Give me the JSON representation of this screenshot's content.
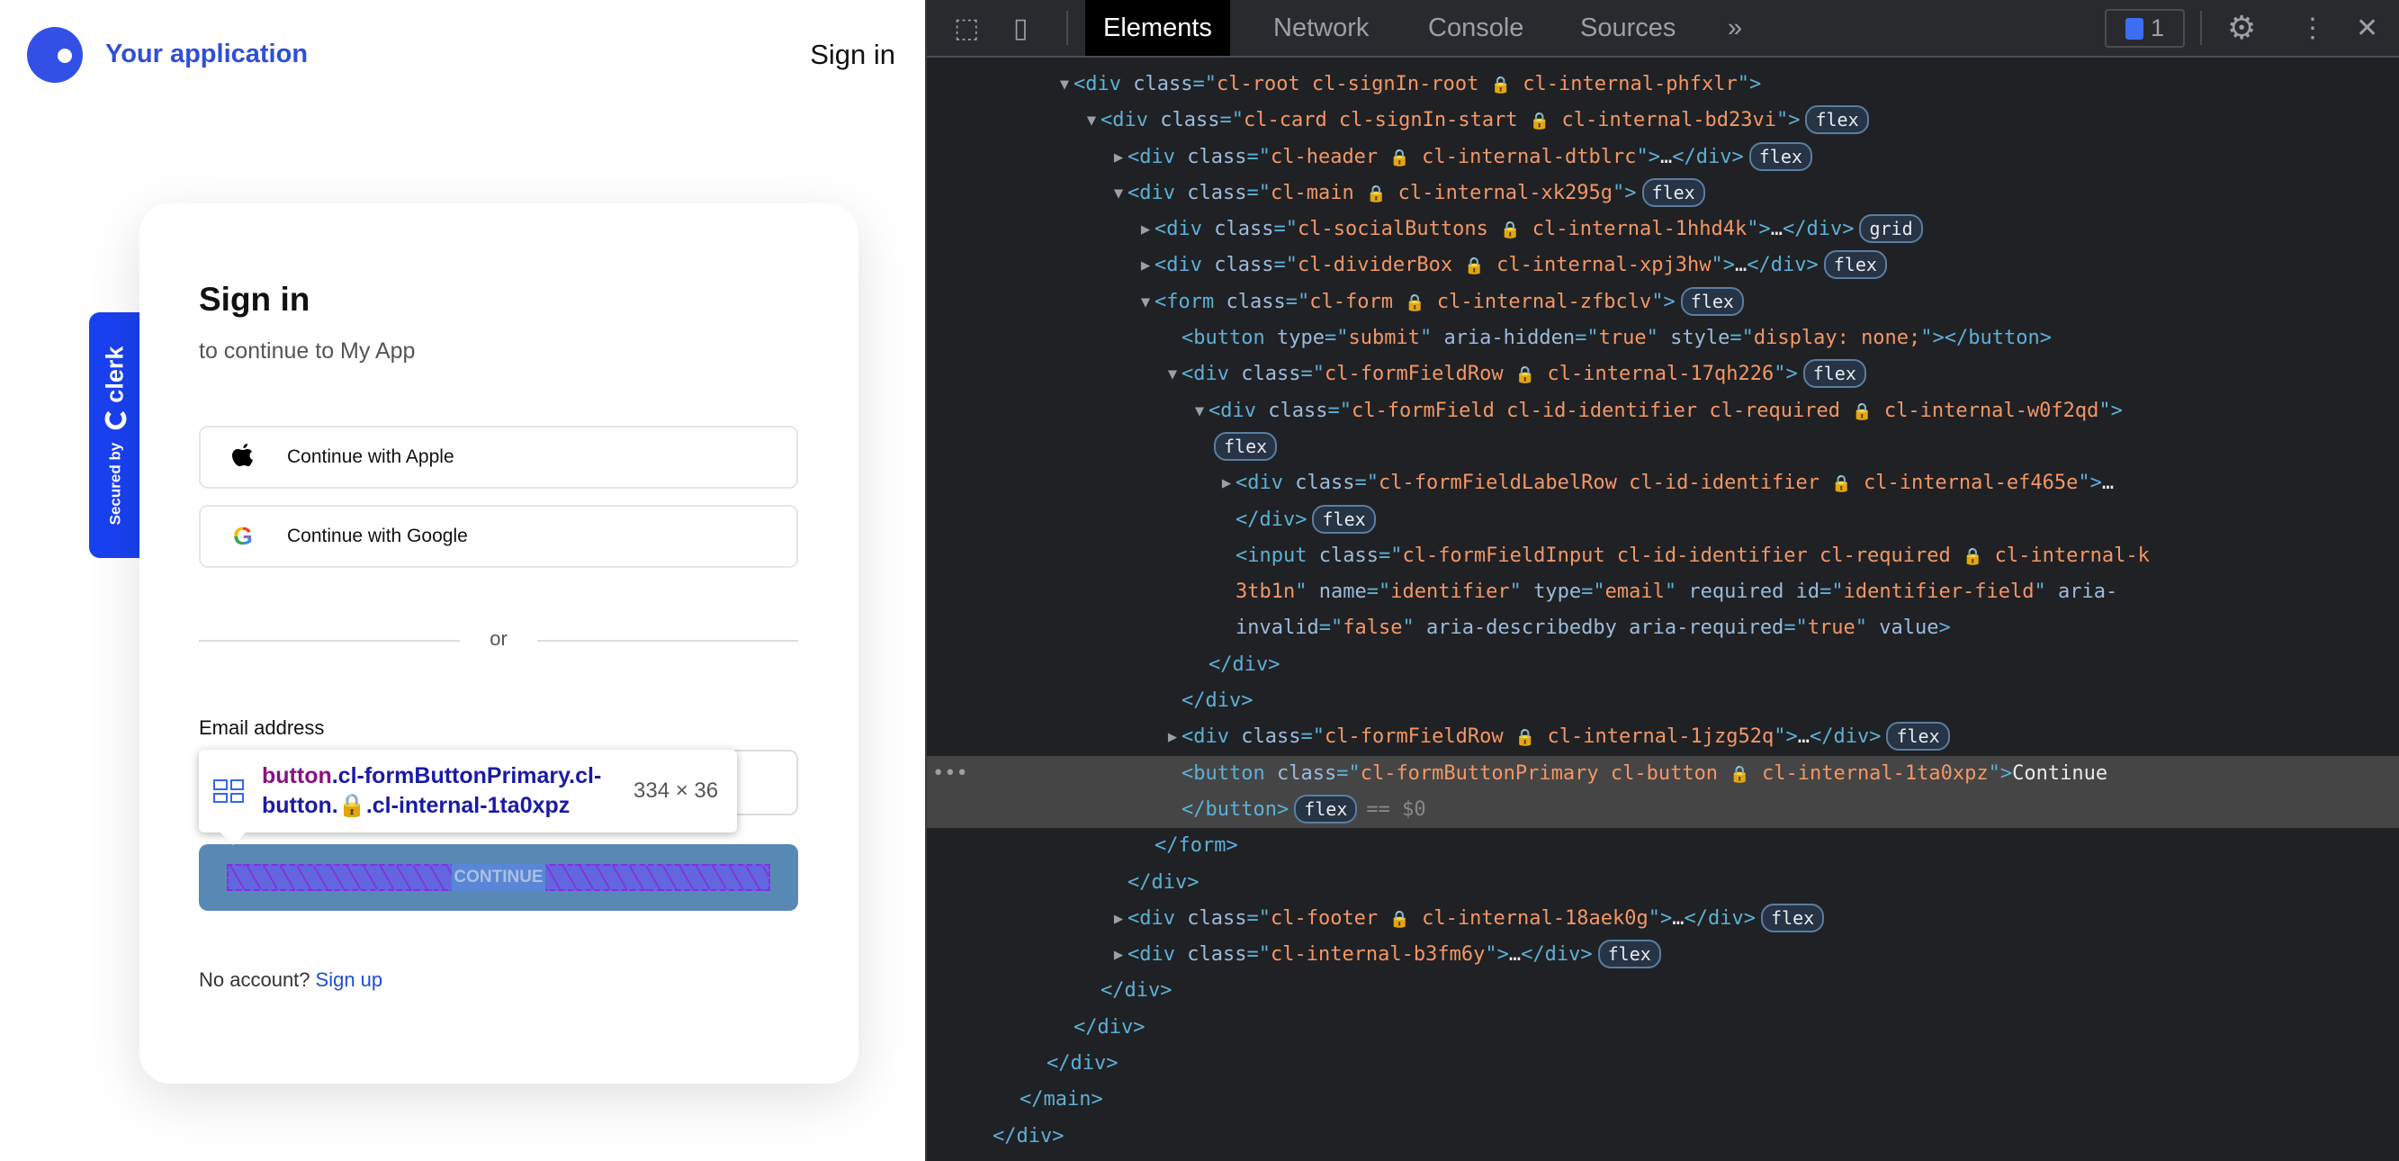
{
  "app": {
    "name": "Your application",
    "top_signin": "Sign in",
    "clerk_badge": {
      "secured_by": "Secured by",
      "brand": "clerk"
    },
    "card": {
      "title": "Sign in",
      "subtitle": "to continue to My App",
      "apple_label": "Continue with Apple",
      "google_label": "Continue with Google",
      "divider": "or",
      "email_label": "Email address",
      "email_value": "",
      "continue_label": "CONTINUE",
      "no_account": "No account?",
      "sign_up": "Sign up"
    },
    "inspect_tooltip": {
      "tag": "button",
      "selector_1": ".cl-formButtonPrimary.cl-",
      "selector_2": "button.",
      "selector_3": ".cl-internal-1ta0xpz",
      "size": "334 × 36"
    },
    "accent": "#1941f0",
    "highlight_color": "#5889b5"
  },
  "devtools": {
    "tabs": [
      "Elements",
      "Network",
      "Console",
      "Sources"
    ],
    "active_tab": "Elements",
    "more": "»",
    "issues_count": "1",
    "icons": [
      "inspect-icon",
      "device-toolbar-icon",
      "issues-icon",
      "gear-icon",
      "more-vertical-icon",
      "close-icon"
    ],
    "colors": {
      "background": "#202124",
      "tag": "#5db0d7",
      "attr_name": "#9bbbdc",
      "attr_value": "#f29766",
      "selected_row": "#454545"
    },
    "selected_suffix": "== $0",
    "lines": [
      {
        "d": 3,
        "t": "open",
        "s": [
          [
            "tag",
            "<div "
          ],
          [
            "an",
            "class"
          ],
          [
            "tag",
            "=\""
          ],
          [
            "av",
            "cl-root cl-signIn-root "
          ],
          [
            "lk",
            "🔒"
          ],
          [
            "av",
            " cl-internal-phfxlr"
          ],
          [
            "tag",
            "\">"
          ]
        ]
      },
      {
        "d": 4,
        "t": "open",
        "s": [
          [
            "tag",
            "<div "
          ],
          [
            "an",
            "class"
          ],
          [
            "tag",
            "=\""
          ],
          [
            "av",
            "cl-card cl-signIn-start "
          ],
          [
            "lk",
            "🔒"
          ],
          [
            "av",
            " cl-internal-bd23vi"
          ],
          [
            "tag",
            "\">"
          ],
          [
            "badge",
            "flex"
          ]
        ]
      },
      {
        "d": 5,
        "t": "closed",
        "s": [
          [
            "tag",
            "<div "
          ],
          [
            "an",
            "class"
          ],
          [
            "tag",
            "=\""
          ],
          [
            "av",
            "cl-header "
          ],
          [
            "lk",
            "🔒"
          ],
          [
            "av",
            " cl-internal-dtblrc"
          ],
          [
            "tag",
            "\">"
          ],
          [
            "tx",
            "…"
          ],
          [
            "tag",
            "</div>"
          ],
          [
            "badge",
            "flex"
          ]
        ]
      },
      {
        "d": 5,
        "t": "open",
        "s": [
          [
            "tag",
            "<div "
          ],
          [
            "an",
            "class"
          ],
          [
            "tag",
            "=\""
          ],
          [
            "av",
            "cl-main "
          ],
          [
            "lk",
            "🔒"
          ],
          [
            "av",
            " cl-internal-xk295g"
          ],
          [
            "tag",
            "\">"
          ],
          [
            "badge",
            "flex"
          ]
        ]
      },
      {
        "d": 6,
        "t": "closed",
        "s": [
          [
            "tag",
            "<div "
          ],
          [
            "an",
            "class"
          ],
          [
            "tag",
            "=\""
          ],
          [
            "av",
            "cl-socialButtons "
          ],
          [
            "lk",
            "🔒"
          ],
          [
            "av",
            " cl-internal-1hhd4k"
          ],
          [
            "tag",
            "\">"
          ],
          [
            "tx",
            "…"
          ],
          [
            "tag",
            "</div>"
          ],
          [
            "badge",
            "grid"
          ]
        ]
      },
      {
        "d": 6,
        "t": "closed",
        "s": [
          [
            "tag",
            "<div "
          ],
          [
            "an",
            "class"
          ],
          [
            "tag",
            "=\""
          ],
          [
            "av",
            "cl-dividerBox "
          ],
          [
            "lk",
            "🔒"
          ],
          [
            "av",
            " cl-internal-xpj3hw"
          ],
          [
            "tag",
            "\">"
          ],
          [
            "tx",
            "…"
          ],
          [
            "tag",
            "</div>"
          ],
          [
            "badge",
            "flex"
          ]
        ]
      },
      {
        "d": 6,
        "t": "open",
        "s": [
          [
            "tag",
            "<form "
          ],
          [
            "an",
            "class"
          ],
          [
            "tag",
            "=\""
          ],
          [
            "av",
            "cl-form "
          ],
          [
            "lk",
            "🔒"
          ],
          [
            "av",
            " cl-internal-zfbclv"
          ],
          [
            "tag",
            "\">"
          ],
          [
            "badge",
            "flex"
          ]
        ]
      },
      {
        "d": 7,
        "s": [
          [
            "tag",
            "<button "
          ],
          [
            "an",
            "type"
          ],
          [
            "tag",
            "=\""
          ],
          [
            "av",
            "submit"
          ],
          [
            "tag",
            "\" "
          ],
          [
            "an",
            "aria-hidden"
          ],
          [
            "tag",
            "=\""
          ],
          [
            "av",
            "true"
          ],
          [
            "tag",
            "\" "
          ],
          [
            "an",
            "style"
          ],
          [
            "tag",
            "=\""
          ],
          [
            "av",
            "display: none;"
          ],
          [
            "tag",
            "\"></button>"
          ]
        ]
      },
      {
        "d": 7,
        "t": "open",
        "s": [
          [
            "tag",
            "<div "
          ],
          [
            "an",
            "class"
          ],
          [
            "tag",
            "=\""
          ],
          [
            "av",
            "cl-formFieldRow "
          ],
          [
            "lk",
            "🔒"
          ],
          [
            "av",
            " cl-internal-17qh226"
          ],
          [
            "tag",
            "\">"
          ],
          [
            "badge",
            "flex"
          ]
        ]
      },
      {
        "d": 8,
        "t": "open",
        "s": [
          [
            "tag",
            "<div "
          ],
          [
            "an",
            "class"
          ],
          [
            "tag",
            "=\""
          ],
          [
            "av",
            "cl-formField cl-id-identifier cl-required "
          ],
          [
            "lk",
            "🔒"
          ],
          [
            "av",
            " cl-internal-w0f2qd"
          ],
          [
            "tag",
            "\">"
          ]
        ]
      },
      {
        "d": 8,
        "s": [
          [
            "badge",
            "flex"
          ]
        ]
      },
      {
        "d": 9,
        "t": "closed",
        "s": [
          [
            "tag",
            "<div "
          ],
          [
            "an",
            "class"
          ],
          [
            "tag",
            "=\""
          ],
          [
            "av",
            "cl-formFieldLabelRow cl-id-identifier "
          ],
          [
            "lk",
            "🔒"
          ],
          [
            "av",
            " cl-internal-ef465e"
          ],
          [
            "tag",
            "\">"
          ],
          [
            "tx",
            "…"
          ]
        ]
      },
      {
        "d": 9,
        "s": [
          [
            "tag",
            "</div>"
          ],
          [
            "badge",
            "flex"
          ]
        ]
      },
      {
        "d": 9,
        "s": [
          [
            "tag",
            "<input "
          ],
          [
            "an",
            "class"
          ],
          [
            "tag",
            "=\""
          ],
          [
            "av",
            "cl-formFieldInput cl-id-identifier cl-required "
          ],
          [
            "lk",
            "🔒"
          ],
          [
            "av",
            " cl-internal-k"
          ]
        ]
      },
      {
        "d": 9,
        "s": [
          [
            "av",
            "3tb1n"
          ],
          [
            "tag",
            "\" "
          ],
          [
            "an",
            "name"
          ],
          [
            "tag",
            "=\""
          ],
          [
            "av",
            "identifier"
          ],
          [
            "tag",
            "\" "
          ],
          [
            "an",
            "type"
          ],
          [
            "tag",
            "=\""
          ],
          [
            "av",
            "email"
          ],
          [
            "tag",
            "\" "
          ],
          [
            "an",
            "required id"
          ],
          [
            "tag",
            "=\""
          ],
          [
            "av",
            "identifier-field"
          ],
          [
            "tag",
            "\" "
          ],
          [
            "an",
            "aria-"
          ]
        ]
      },
      {
        "d": 9,
        "s": [
          [
            "an",
            "invalid"
          ],
          [
            "tag",
            "=\""
          ],
          [
            "av",
            "false"
          ],
          [
            "tag",
            "\" "
          ],
          [
            "an",
            "aria-describedby aria-required"
          ],
          [
            "tag",
            "=\""
          ],
          [
            "av",
            "true"
          ],
          [
            "tag",
            "\" "
          ],
          [
            "an",
            "value"
          ],
          [
            "tag",
            ">"
          ]
        ]
      },
      {
        "d": 8,
        "s": [
          [
            "tag",
            "</div>"
          ]
        ]
      },
      {
        "d": 7,
        "s": [
          [
            "tag",
            "</div>"
          ]
        ]
      },
      {
        "d": 7,
        "t": "closed",
        "s": [
          [
            "tag",
            "<div "
          ],
          [
            "an",
            "class"
          ],
          [
            "tag",
            "=\""
          ],
          [
            "av",
            "cl-formFieldRow "
          ],
          [
            "lk",
            "🔒"
          ],
          [
            "av",
            " cl-internal-1jzg52q"
          ],
          [
            "tag",
            "\">"
          ],
          [
            "tx",
            "…"
          ],
          [
            "tag",
            "</div>"
          ],
          [
            "badge",
            "flex"
          ]
        ]
      },
      {
        "d": 7,
        "sel": true,
        "dots": "•••",
        "s": [
          [
            "tag",
            "<button "
          ],
          [
            "an",
            "class"
          ],
          [
            "tag",
            "=\""
          ],
          [
            "av",
            "cl-formButtonPrimary cl-button "
          ],
          [
            "lk",
            "🔒"
          ],
          [
            "av",
            " cl-internal-1ta0xpz"
          ],
          [
            "tag",
            "\">"
          ],
          [
            "tx",
            "Continue"
          ]
        ]
      },
      {
        "d": 7,
        "sel": true,
        "s": [
          [
            "tag",
            "</button>"
          ],
          [
            "badge",
            "flex"
          ],
          [
            "eq",
            "== $0"
          ]
        ]
      },
      {
        "d": 6,
        "s": [
          [
            "tag",
            "</form>"
          ]
        ]
      },
      {
        "d": 5,
        "s": [
          [
            "tag",
            "</div>"
          ]
        ]
      },
      {
        "d": 5,
        "t": "closed",
        "s": [
          [
            "tag",
            "<div "
          ],
          [
            "an",
            "class"
          ],
          [
            "tag",
            "=\""
          ],
          [
            "av",
            "cl-footer "
          ],
          [
            "lk",
            "🔒"
          ],
          [
            "av",
            " cl-internal-18aek0g"
          ],
          [
            "tag",
            "\">"
          ],
          [
            "tx",
            "…"
          ],
          [
            "tag",
            "</div>"
          ],
          [
            "badge",
            "flex"
          ]
        ]
      },
      {
        "d": 5,
        "t": "closed",
        "s": [
          [
            "tag",
            "<div "
          ],
          [
            "an",
            "class"
          ],
          [
            "tag",
            "=\""
          ],
          [
            "av",
            "cl-internal-b3fm6y"
          ],
          [
            "tag",
            "\">"
          ],
          [
            "tx",
            "…"
          ],
          [
            "tag",
            "</div>"
          ],
          [
            "badge",
            "flex"
          ]
        ]
      },
      {
        "d": 4,
        "s": [
          [
            "tag",
            "</div>"
          ]
        ]
      },
      {
        "d": 3,
        "s": [
          [
            "tag",
            "</div>"
          ]
        ]
      },
      {
        "d": 2,
        "s": [
          [
            "tag",
            "</div>"
          ]
        ]
      },
      {
        "d": 1,
        "s": [
          [
            "tag",
            "</main>"
          ]
        ]
      },
      {
        "d": 0,
        "s": [
          [
            "tag",
            "</div>"
          ]
        ]
      }
    ]
  }
}
